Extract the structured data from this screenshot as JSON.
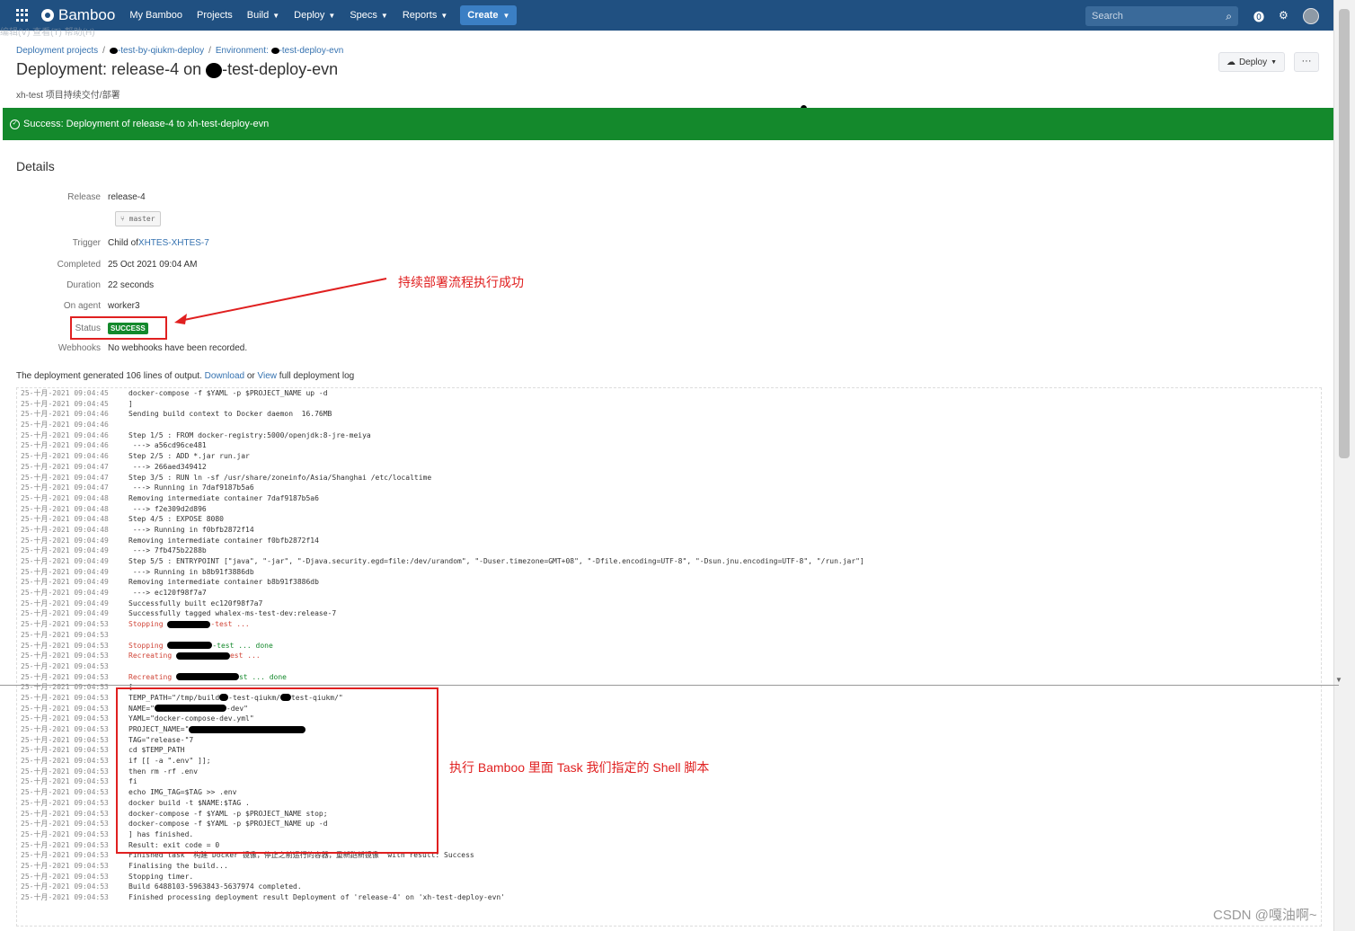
{
  "nav": {
    "logo": "Bamboo",
    "items": [
      "My Bamboo",
      "Projects",
      "Build",
      "Deploy",
      "Specs",
      "Reports"
    ],
    "create": "Create",
    "search_placeholder": "Search",
    "icons": [
      "apps-grid-icon",
      "help-icon",
      "settings-gear-icon",
      "user-avatar"
    ]
  },
  "ghost_menu": "编辑(V)  查看(T)  帮助(H)",
  "breadcrumb": {
    "root": "Deployment projects",
    "project": "-test-by-qiukm-deploy",
    "environment": "Environment: ",
    "environment_name": "-test-deploy-evn"
  },
  "page": {
    "title_prefix": "Deployment: release-4 on ",
    "title_suffix": "-test-deploy-evn",
    "subtitle": "xh-test 项目持续交付/部署",
    "deploy_button": "Deploy",
    "more_button": "···"
  },
  "success_message": "Success: Deployment of release-4 to xh-test-deploy-evn",
  "details": {
    "heading": "Details",
    "release_label": "Release",
    "release_value": "release-4",
    "branch": "master",
    "trigger_label": "Trigger",
    "trigger_prefix": "Child of ",
    "trigger_link": "XHTES-XHTES-7",
    "completed_label": "Completed",
    "completed_value": "25 Oct 2021 09:04 AM",
    "duration_label": "Duration",
    "duration_value": "22 seconds",
    "agent_label": "On agent",
    "agent_value": "worker3",
    "status_label": "Status",
    "status_value": "SUCCESS",
    "webhooks_label": "Webhooks",
    "webhooks_value": "No webhooks have been recorded."
  },
  "annotations": {
    "status_note": "持续部署流程执行成功",
    "shell_note": "执行 Bamboo 里面 Task 我们指定的 Shell 脚本"
  },
  "output": {
    "prefix": "The deployment generated 106 lines of output. ",
    "download": "Download",
    "or": " or ",
    "view": "View",
    "suffix": " full deployment log"
  },
  "log": [
    {
      "ts": "25-十月-2021 09:04:45",
      "text": "docker-compose -f $YAML -p $PROJECT_NAME up -d"
    },
    {
      "ts": "25-十月-2021 09:04:45",
      "text": "]"
    },
    {
      "ts": "25-十月-2021 09:04:46",
      "text": "Sending build context to Docker daemon  16.76MB"
    },
    {
      "ts": "25-十月-2021 09:04:46",
      "text": ""
    },
    {
      "ts": "25-十月-2021 09:04:46",
      "text": "Step 1/5 : FROM docker-registry:5000/openjdk:8-jre-meiya"
    },
    {
      "ts": "25-十月-2021 09:04:46",
      "text": " ---> a56cd96ce481"
    },
    {
      "ts": "25-十月-2021 09:04:46",
      "text": "Step 2/5 : ADD *.jar run.jar"
    },
    {
      "ts": "25-十月-2021 09:04:47",
      "text": " ---> 266aed349412"
    },
    {
      "ts": "25-十月-2021 09:04:47",
      "text": "Step 3/5 : RUN ln -sf /usr/share/zoneinfo/Asia/Shanghai /etc/localtime"
    },
    {
      "ts": "25-十月-2021 09:04:47",
      "text": " ---> Running in 7daf9187b5a6"
    },
    {
      "ts": "25-十月-2021 09:04:48",
      "text": "Removing intermediate container 7daf9187b5a6"
    },
    {
      "ts": "25-十月-2021 09:04:48",
      "text": " ---> f2e309d2d896"
    },
    {
      "ts": "25-十月-2021 09:04:48",
      "text": "Step 4/5 : EXPOSE 8080"
    },
    {
      "ts": "25-十月-2021 09:04:48",
      "text": " ---> Running in f0bfb2872f14"
    },
    {
      "ts": "25-十月-2021 09:04:49",
      "text": "Removing intermediate container f0bfb2872f14"
    },
    {
      "ts": "25-十月-2021 09:04:49",
      "text": " ---> 7fb475b2288b"
    },
    {
      "ts": "25-十月-2021 09:04:49",
      "text": "Step 5/5 : ENTRYPOINT [\"java\", \"-jar\", \"-Djava.security.egd=file:/dev/urandom\", \"-Duser.timezone=GMT+08\", \"-Dfile.encoding=UTF-8\", \"-Dsun.jnu.encoding=UTF-8\", \"/run.jar\"]"
    },
    {
      "ts": "25-十月-2021 09:04:49",
      "text": " ---> Running in b8b91f3886db"
    },
    {
      "ts": "25-十月-2021 09:04:49",
      "text": "Removing intermediate container b8b91f3886db"
    },
    {
      "ts": "25-十月-2021 09:04:49",
      "text": " ---> ec120f98f7a7"
    },
    {
      "ts": "25-十月-2021 09:04:49",
      "text": "Successfully built ec120f98f7a7"
    },
    {
      "ts": "25-十月-2021 09:04:49",
      "text": "Successfully tagged whalex-ms-test-dev:release-7"
    },
    {
      "ts": "25-十月-2021 09:04:53",
      "text": "Stopping ",
      "after": "-test ...",
      "redact": 48,
      "color": "red"
    },
    {
      "ts": "25-十月-2021 09:04:53",
      "text": ""
    },
    {
      "ts": "25-十月-2021 09:04:53",
      "text": "Stopping ",
      "after": "-test ... done",
      "redact": 50,
      "color": "mixed"
    },
    {
      "ts": "25-十月-2021 09:04:53",
      "text": "Recreating ",
      "after": "est ...",
      "redact": 60,
      "color": "red"
    },
    {
      "ts": "25-十月-2021 09:04:53",
      "text": ""
    },
    {
      "ts": "25-十月-2021 09:04:53",
      "text": "Recreating ",
      "after": "st ... done",
      "redact": 70,
      "color": "mixed"
    },
    {
      "ts": "25-十月-2021 09:04:53",
      "text": "["
    },
    {
      "ts": "25-十月-2021 09:04:53",
      "text": "TEMP_PATH=\"/tmp/build",
      "after": "-test-qiukm/",
      "redact": 10,
      "after2": "test-qiukm/\""
    },
    {
      "ts": "25-十月-2021 09:04:53",
      "text": "NAME=\"",
      "after": "-dev\"",
      "redact": 80
    },
    {
      "ts": "25-十月-2021 09:04:53",
      "text": "YAML=\"docker-compose-dev.yml\""
    },
    {
      "ts": "25-十月-2021 09:04:53",
      "text": "PROJECT_NAME=\"",
      "after": "",
      "redact": 130
    },
    {
      "ts": "25-十月-2021 09:04:53",
      "text": "TAG=\"release-\"7"
    },
    {
      "ts": "25-十月-2021 09:04:53",
      "text": "cd $TEMP_PATH"
    },
    {
      "ts": "25-十月-2021 09:04:53",
      "text": "if [[ -a \".env\" ]];"
    },
    {
      "ts": "25-十月-2021 09:04:53",
      "text": "then rm -rf .env"
    },
    {
      "ts": "25-十月-2021 09:04:53",
      "text": "fi"
    },
    {
      "ts": "25-十月-2021 09:04:53",
      "text": "echo IMG_TAG=$TAG >> .env"
    },
    {
      "ts": "25-十月-2021 09:04:53",
      "text": "docker build -t $NAME:$TAG ."
    },
    {
      "ts": "25-十月-2021 09:04:53",
      "text": "docker-compose -f $YAML -p $PROJECT_NAME stop;"
    },
    {
      "ts": "25-十月-2021 09:04:53",
      "text": "docker-compose -f $YAML -p $PROJECT_NAME up -d"
    },
    {
      "ts": "25-十月-2021 09:04:53",
      "text": "] has finished."
    },
    {
      "ts": "25-十月-2021 09:04:53",
      "text": "Result: exit code = 0"
    },
    {
      "ts": "25-十月-2021 09:04:53",
      "text": "Finished task '构建 Docker 镜像，停止之前运行的容器，重新跑新镜像' with result: Success"
    },
    {
      "ts": "25-十月-2021 09:04:53",
      "text": "Finalising the build..."
    },
    {
      "ts": "25-十月-2021 09:04:53",
      "text": "Stopping timer."
    },
    {
      "ts": "25-十月-2021 09:04:53",
      "text": "Build 6488103-5963843-5637974 completed."
    },
    {
      "ts": "25-十月-2021 09:04:53",
      "text": "Finished processing deployment result Deployment of 'release-4' on 'xh-test-deploy-evn'"
    }
  ],
  "watermark": "CSDN @嘎油啊~"
}
